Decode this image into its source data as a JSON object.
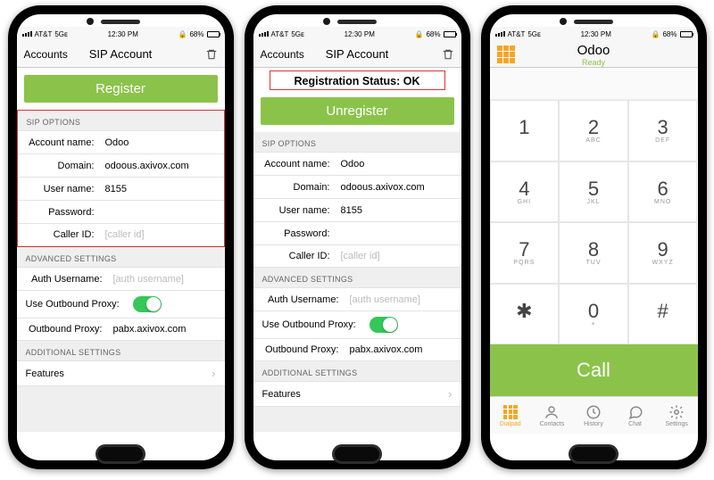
{
  "status": {
    "carrier": "AT&T",
    "net": "5Gᴇ",
    "time": "12:30 PM",
    "battery": "68%"
  },
  "screen1": {
    "back": "Accounts",
    "title": "SIP Account",
    "register_btn": "Register",
    "sections": {
      "sip": "SIP OPTIONS",
      "adv": "ADVANCED SETTINGS",
      "add": "ADDITIONAL SETTINGS"
    },
    "fields": {
      "account_label": "Account name:",
      "account_value": "Odoo",
      "domain_label": "Domain:",
      "domain_value": "odoous.axivox.com",
      "user_label": "User name:",
      "user_value": "8155",
      "pass_label": "Password:",
      "pass_value": "",
      "caller_label": "Caller ID:",
      "caller_ph": "[caller id]",
      "auth_label": "Auth Username:",
      "auth_ph": "[auth username]",
      "proxy_toggle_label": "Use Outbound Proxy:",
      "proxy_label": "Outbound Proxy:",
      "proxy_value": "pabx.axivox.com",
      "features": "Features"
    }
  },
  "screen2": {
    "back": "Accounts",
    "title": "SIP Account",
    "reg_status": "Registration Status: OK",
    "register_btn": "Unregister"
  },
  "screen3": {
    "name": "Odoo",
    "ready": "Ready",
    "keys": [
      {
        "n": "1",
        "l": ""
      },
      {
        "n": "2",
        "l": "ABC"
      },
      {
        "n": "3",
        "l": "DEF"
      },
      {
        "n": "4",
        "l": "GHI"
      },
      {
        "n": "5",
        "l": "JKL"
      },
      {
        "n": "6",
        "l": "MNO"
      },
      {
        "n": "7",
        "l": "PQRS"
      },
      {
        "n": "8",
        "l": "TUV"
      },
      {
        "n": "9",
        "l": "WXYZ"
      },
      {
        "n": "✱",
        "l": ""
      },
      {
        "n": "0",
        "l": "+"
      },
      {
        "n": "#",
        "l": ""
      }
    ],
    "call": "Call",
    "tabs": {
      "dialpad": "Dialpad",
      "contacts": "Contacts",
      "history": "History",
      "chat": "Chat",
      "settings": "Settings"
    }
  }
}
